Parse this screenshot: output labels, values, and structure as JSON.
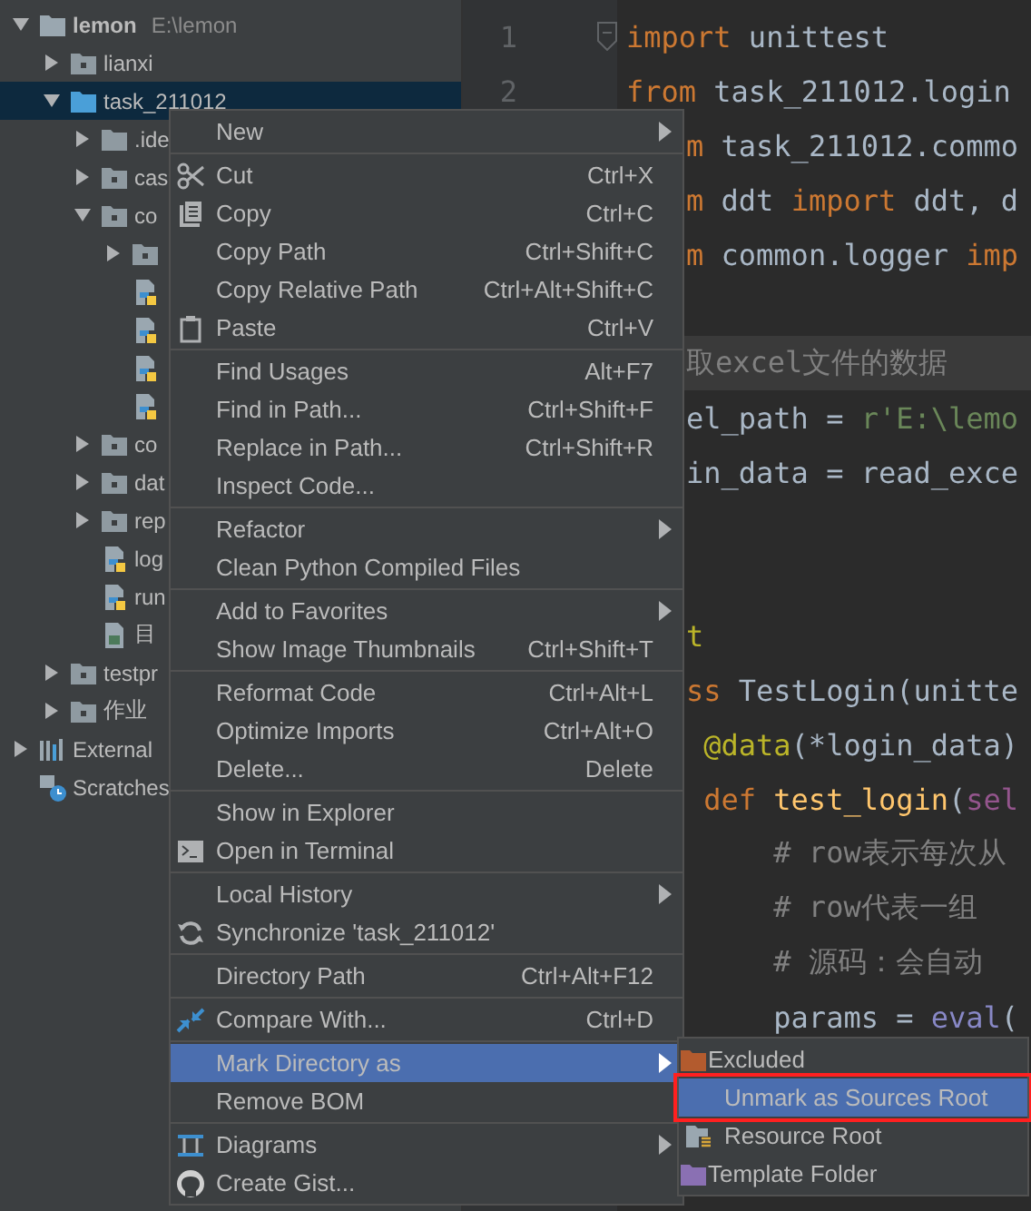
{
  "project_tree": [
    {
      "label": "lemon",
      "path": "E:\\lemon",
      "kind": "module_root",
      "expanded": true,
      "selected": false,
      "children": [
        {
          "label": "lianxi",
          "kind": "folder",
          "expanded": false,
          "selected": false
        },
        {
          "label": "task_211012",
          "kind": "source_folder",
          "expanded": true,
          "selected": true,
          "children": [
            {
              "label": ".ide",
              "kind": "plain_folder",
              "expanded": false,
              "selected": false
            },
            {
              "label": "cas",
              "kind": "folder",
              "expanded": false,
              "selected": false
            },
            {
              "label": "co",
              "kind": "folder",
              "expanded": true,
              "selected": false,
              "children": [
                {
                  "kind": "folder",
                  "expanded": false,
                  "selected": false
                },
                {
                  "kind": "python_file",
                  "selected": false
                },
                {
                  "kind": "python_file",
                  "selected": false
                },
                {
                  "kind": "python_file",
                  "selected": false
                },
                {
                  "kind": "python_file",
                  "selected": false
                }
              ]
            },
            {
              "label": "co",
              "kind": "folder",
              "expanded": false,
              "selected": false
            },
            {
              "label": "dat",
              "kind": "folder",
              "expanded": false,
              "selected": false
            },
            {
              "label": "rep",
              "kind": "folder",
              "expanded": false,
              "selected": false
            },
            {
              "label": "log",
              "kind": "python_file",
              "selected": false
            },
            {
              "label": "run",
              "kind": "python_file",
              "selected": false
            },
            {
              "label": "目",
              "kind": "image_file",
              "selected": false
            }
          ]
        },
        {
          "label": "testpr",
          "kind": "folder",
          "expanded": false,
          "selected": false
        },
        {
          "label": "作业",
          "kind": "folder",
          "expanded": false,
          "selected": false
        }
      ]
    },
    {
      "label": "External",
      "kind": "library",
      "expanded": false,
      "selected": false
    },
    {
      "label": "Scratches",
      "kind": "scratches",
      "selected": false
    }
  ],
  "editor": {
    "lines": [
      {
        "kind": "full",
        "number": "1",
        "fold": true,
        "highlighted": false,
        "tokens": [
          {
            "kind": "keyword",
            "text": "import"
          },
          {
            "kind": "plain",
            "text": " unittest"
          }
        ]
      },
      {
        "kind": "full",
        "number": "2",
        "highlighted": false,
        "tokens": [
          {
            "kind": "keyword",
            "text": "from"
          },
          {
            "kind": "plain",
            "text": " task_211012.login"
          }
        ]
      },
      {
        "kind": "cut",
        "highlighted": false,
        "tokens": [
          {
            "kind": "keyword",
            "text": "m"
          },
          {
            "kind": "plain",
            "text": " task_211012.commo"
          }
        ]
      },
      {
        "kind": "cut",
        "highlighted": false,
        "tokens": [
          {
            "kind": "keyword",
            "text": "m"
          },
          {
            "kind": "plain",
            "text": " ddt "
          },
          {
            "kind": "keyword",
            "text": "import"
          },
          {
            "kind": "plain",
            "text": " ddt, d"
          }
        ]
      },
      {
        "kind": "cut",
        "highlighted": false,
        "tokens": [
          {
            "kind": "keyword",
            "text": "m"
          },
          {
            "kind": "plain",
            "text": " common.logger "
          },
          {
            "kind": "keyword",
            "text": "imp"
          }
        ]
      },
      {
        "kind": "blank",
        "highlighted": false
      },
      {
        "kind": "cut",
        "highlighted": true,
        "tokens": [
          {
            "kind": "comment",
            "text": "取excel文件的数据"
          }
        ]
      },
      {
        "kind": "cut",
        "highlighted": false,
        "tokens": [
          {
            "kind": "plain",
            "text": "el_path = "
          },
          {
            "kind": "string",
            "text": "r'E:\\lemo"
          }
        ]
      },
      {
        "kind": "cut",
        "highlighted": false,
        "tokens": [
          {
            "kind": "plain",
            "text": "in_data = read_exce"
          }
        ]
      },
      {
        "kind": "blank",
        "highlighted": false
      },
      {
        "kind": "blank",
        "highlighted": false
      },
      {
        "kind": "cut",
        "highlighted": false,
        "tokens": [
          {
            "kind": "decorator",
            "text": "t"
          }
        ]
      },
      {
        "kind": "cut",
        "highlighted": false,
        "tokens": [
          {
            "kind": "keyword",
            "text": "ss"
          },
          {
            "kind": "plain",
            "text": " TestLogin(unitte"
          }
        ]
      },
      {
        "kind": "cut",
        "highlighted": false,
        "tokens": [
          {
            "kind": "decorator",
            "text": " @data"
          },
          {
            "kind": "plain",
            "text": "(*login_data)"
          }
        ]
      },
      {
        "kind": "cut",
        "highlighted": false,
        "tokens": [
          {
            "kind": "keyword",
            "text": " def"
          },
          {
            "kind": "function",
            "text": " test_login"
          },
          {
            "kind": "plain",
            "text": "("
          },
          {
            "kind": "self",
            "text": "sel"
          }
        ]
      },
      {
        "kind": "cut",
        "highlighted": false,
        "tokens": [
          {
            "kind": "comment",
            "text": "     # row表示每次从"
          }
        ]
      },
      {
        "kind": "cut",
        "highlighted": false,
        "tokens": [
          {
            "kind": "comment",
            "text": "     # row代表一组"
          }
        ]
      },
      {
        "kind": "cut",
        "highlighted": false,
        "tokens": [
          {
            "kind": "comment",
            "text": "     # 源码：会自动"
          }
        ]
      },
      {
        "kind": "cut",
        "highlighted": false,
        "tokens": [
          {
            "kind": "plain",
            "text": "     params = "
          },
          {
            "kind": "builtin",
            "text": "eval"
          },
          {
            "kind": "plain",
            "text": "("
          }
        ]
      }
    ]
  },
  "context_menu": {
    "items": [
      {
        "kind": "plain",
        "label": "New",
        "submenu": true,
        "selected": false
      },
      {
        "kind": "separator"
      },
      {
        "kind": "cut",
        "label": "Cut",
        "shortcut": "Ctrl+X",
        "submenu": false,
        "selected": false
      },
      {
        "kind": "copy",
        "label": "Copy",
        "shortcut": "Ctrl+C",
        "submenu": false,
        "selected": false
      },
      {
        "kind": "plain",
        "label": "Copy Path",
        "shortcut": "Ctrl+Shift+C",
        "submenu": false,
        "selected": false
      },
      {
        "kind": "plain",
        "label": "Copy Relative Path",
        "shortcut": "Ctrl+Alt+Shift+C",
        "submenu": false,
        "selected": false
      },
      {
        "kind": "paste",
        "label": "Paste",
        "shortcut": "Ctrl+V",
        "submenu": false,
        "selected": false
      },
      {
        "kind": "separator"
      },
      {
        "kind": "plain",
        "label": "Find Usages",
        "shortcut": "Alt+F7",
        "submenu": false,
        "selected": false
      },
      {
        "kind": "plain",
        "label": "Find in Path...",
        "shortcut": "Ctrl+Shift+F",
        "submenu": false,
        "selected": false
      },
      {
        "kind": "plain",
        "label": "Replace in Path...",
        "shortcut": "Ctrl+Shift+R",
        "submenu": false,
        "selected": false
      },
      {
        "kind": "plain",
        "label": "Inspect Code...",
        "submenu": false,
        "selected": false
      },
      {
        "kind": "separator"
      },
      {
        "kind": "plain",
        "label": "Refactor",
        "submenu": true,
        "selected": false
      },
      {
        "kind": "plain",
        "label": "Clean Python Compiled Files",
        "submenu": false,
        "selected": false
      },
      {
        "kind": "separator"
      },
      {
        "kind": "plain",
        "label": "Add to Favorites",
        "submenu": true,
        "selected": false
      },
      {
        "kind": "plain",
        "label": "Show Image Thumbnails",
        "shortcut": "Ctrl+Shift+T",
        "submenu": false,
        "selected": false
      },
      {
        "kind": "separator"
      },
      {
        "kind": "plain",
        "label": "Reformat Code",
        "shortcut": "Ctrl+Alt+L",
        "submenu": false,
        "selected": false
      },
      {
        "kind": "plain",
        "label": "Optimize Imports",
        "shortcut": "Ctrl+Alt+O",
        "submenu": false,
        "selected": false
      },
      {
        "kind": "plain",
        "label": "Delete...",
        "shortcut": "Delete",
        "submenu": false,
        "selected": false
      },
      {
        "kind": "separator"
      },
      {
        "kind": "plain",
        "label": "Show in Explorer",
        "submenu": false,
        "selected": false
      },
      {
        "kind": "terminal",
        "label": "Open in Terminal",
        "submenu": false,
        "selected": false
      },
      {
        "kind": "separator"
      },
      {
        "kind": "plain",
        "label": "Local History",
        "submenu": true,
        "selected": false
      },
      {
        "kind": "sync",
        "label": "Synchronize 'task_211012'",
        "submenu": false,
        "selected": false
      },
      {
        "kind": "separator"
      },
      {
        "kind": "plain",
        "label": "Directory Path",
        "shortcut": "Ctrl+Alt+F12",
        "submenu": false,
        "selected": false
      },
      {
        "kind": "separator"
      },
      {
        "kind": "compare",
        "label": "Compare With...",
        "shortcut": "Ctrl+D",
        "submenu": false,
        "selected": false
      },
      {
        "kind": "separator"
      },
      {
        "kind": "plain",
        "label": "Mark Directory as",
        "submenu": true,
        "selected": true
      },
      {
        "kind": "plain",
        "label": "Remove BOM",
        "submenu": false,
        "selected": false
      },
      {
        "kind": "separator"
      },
      {
        "kind": "diagrams",
        "label": "Diagrams",
        "submenu": true,
        "selected": false
      },
      {
        "kind": "gist",
        "label": "Create Gist...",
        "submenu": false,
        "selected": false
      }
    ]
  },
  "submenu": {
    "items": [
      {
        "kind": "excluded",
        "label": "Excluded",
        "selected": false,
        "outlined": false
      },
      {
        "kind": "plain",
        "label": "Unmark as Sources Root",
        "selected": true,
        "outlined": true
      },
      {
        "kind": "resource",
        "label": "Resource Root",
        "selected": false,
        "outlined": false
      },
      {
        "kind": "template",
        "label": "Template Folder",
        "selected": false,
        "outlined": false
      }
    ]
  }
}
